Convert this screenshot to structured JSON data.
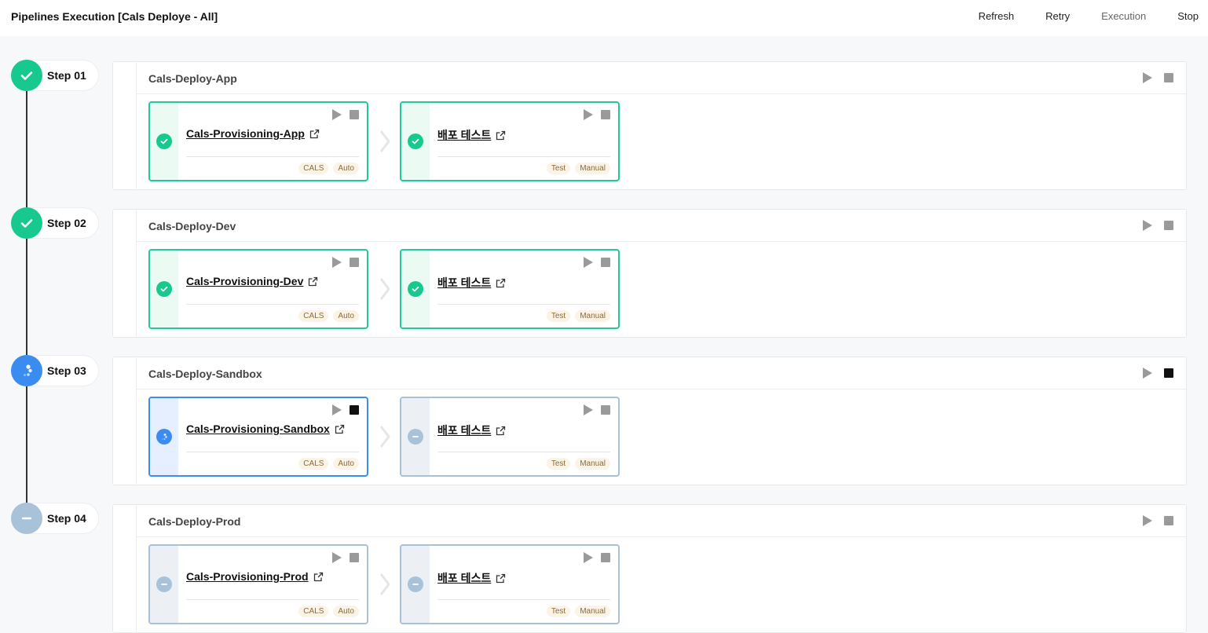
{
  "header": {
    "title": "Pipelines Execution [Cals Deploye - All]",
    "actions": [
      "Refresh",
      "Retry",
      "Execution",
      "Stop"
    ]
  },
  "steps": [
    {
      "label": "Step 01",
      "status": "success",
      "stage": "Cals-Deploy-App",
      "jobs": [
        {
          "name": "Cals-Provisioning-App",
          "status": "success",
          "tags": [
            "CALS",
            "Auto"
          ]
        },
        {
          "name": "배포 테스트",
          "status": "success",
          "tags": [
            "Test",
            "Manual"
          ]
        }
      ]
    },
    {
      "label": "Step 02",
      "status": "success",
      "stage": "Cals-Deploy-Dev",
      "jobs": [
        {
          "name": "Cals-Provisioning-Dev",
          "status": "success",
          "tags": [
            "CALS",
            "Auto"
          ]
        },
        {
          "name": "배포 테스트",
          "status": "success",
          "tags": [
            "Test",
            "Manual"
          ]
        }
      ]
    },
    {
      "label": "Step 03",
      "status": "running",
      "stage": "Cals-Deploy-Sandbox",
      "jobs": [
        {
          "name": "Cals-Provisioning-Sandbox",
          "status": "running",
          "tags": [
            "CALS",
            "Auto"
          ]
        },
        {
          "name": "배포 테스트",
          "status": "pending",
          "tags": [
            "Test",
            "Manual"
          ]
        }
      ]
    },
    {
      "label": "Step 04",
      "status": "pending",
      "stage": "Cals-Deploy-Prod",
      "jobs": [
        {
          "name": "Cals-Provisioning-Prod",
          "status": "pending",
          "tags": [
            "CALS",
            "Auto"
          ]
        },
        {
          "name": "배포 테스트",
          "status": "pending",
          "tags": [
            "Test",
            "Manual"
          ]
        }
      ]
    }
  ],
  "colors": {
    "success": "#17c98f",
    "running": "#3b8cf0",
    "pending": "#a8c2da"
  },
  "icons": {
    "success": "check-icon",
    "running": "spinner-icon",
    "pending": "minus-icon",
    "link": "external-link-icon"
  }
}
